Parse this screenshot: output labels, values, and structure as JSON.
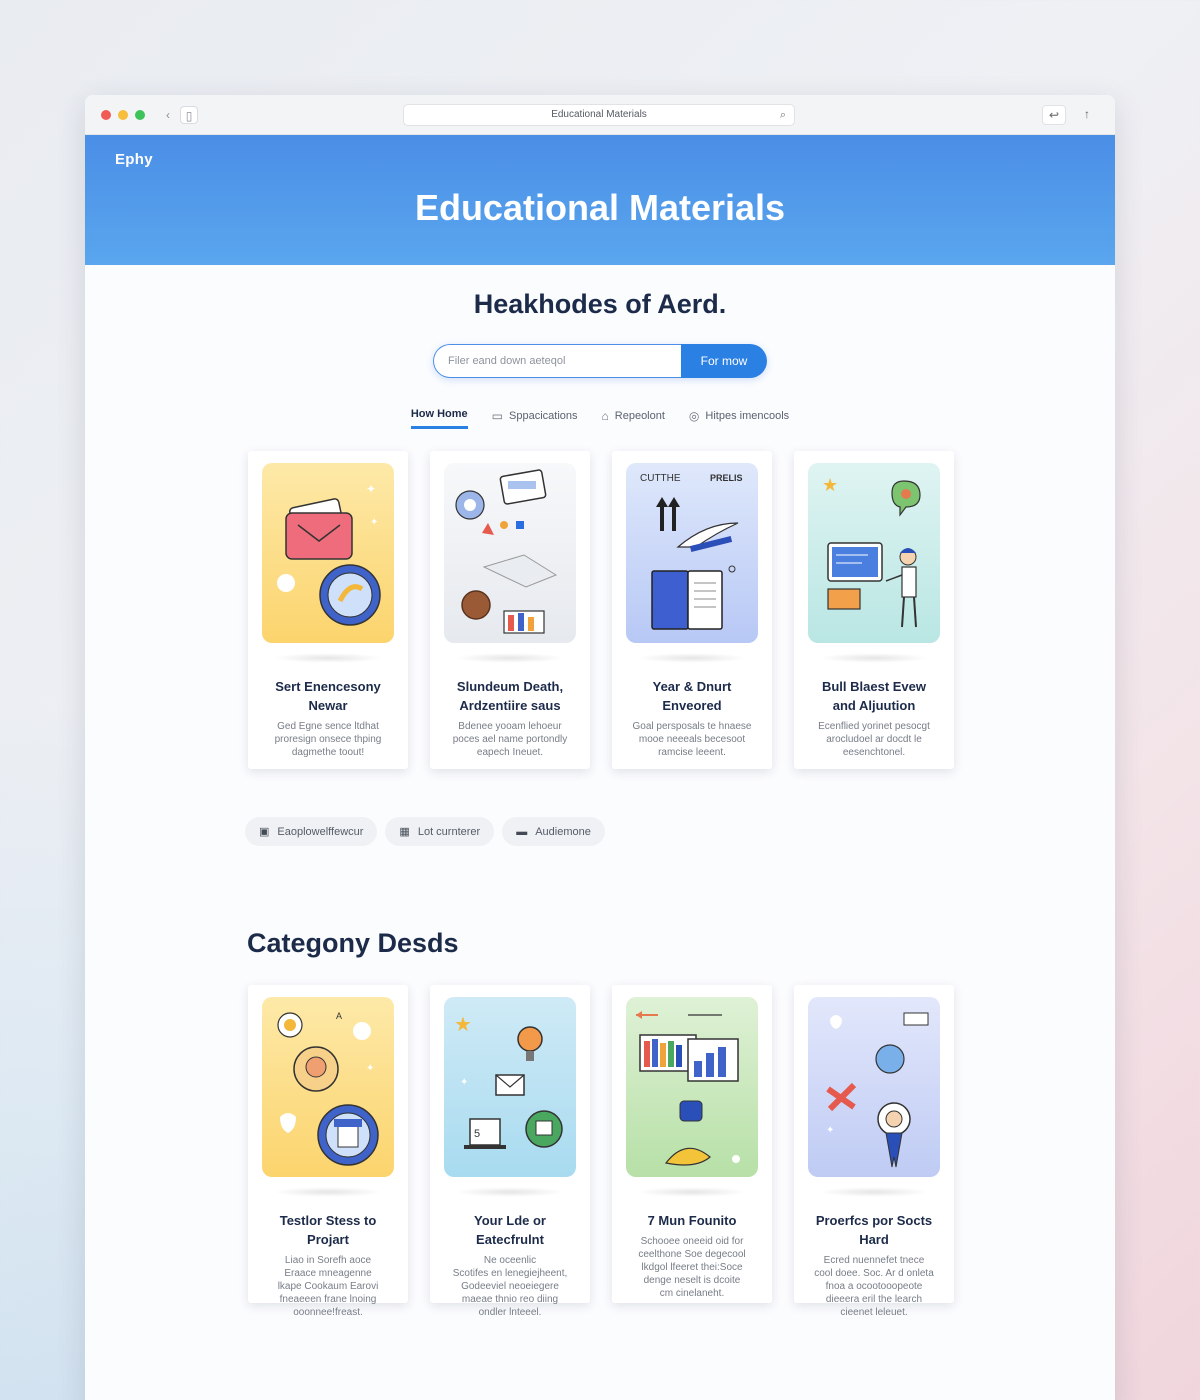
{
  "browser": {
    "address": "Educational Materials",
    "back_glyph": "‹",
    "forward_glyph": "▯"
  },
  "brand": "Ephy",
  "hero_title": "Educational Materials",
  "subtitle": "Heakhodes of Aerd.",
  "search": {
    "placeholder": "Filer eand down aeteqol",
    "button_label": "For mow"
  },
  "tabs": [
    {
      "label": "How Home",
      "icon": "none",
      "active": true
    },
    {
      "label": "Sppacications",
      "icon": "monitor-icon",
      "active": false
    },
    {
      "label": "Repeolont",
      "icon": "lock-icon",
      "active": false
    },
    {
      "label": "Hitpes imencools",
      "icon": "target-icon",
      "active": false
    }
  ],
  "cards_top": [
    {
      "title_line1": "Sert Enencesony",
      "title_line2": "Newar",
      "desc_line1": "Ged Egne sence ltdhat",
      "desc_line2": "proresign onsece thping",
      "desc_line3": "dagmethe toout!",
      "art": "yellow"
    },
    {
      "title_line1": "Slundeum Death,",
      "title_line2": "Ardzentiire saus",
      "desc_line1": "Bdenee yooam lehoeur",
      "desc_line2": "poces ael name portondly",
      "desc_line3": "eapech Ineuet.",
      "art": "grey"
    },
    {
      "title_line1": "Year & Dnurt",
      "title_line2": "Enveored",
      "desc_line1": "Goal persposals te hnaese",
      "desc_line2": "mooe neeeals becesoot",
      "desc_line3": "ramcise leeent.",
      "art": "blue"
    },
    {
      "title_line1": "Bull Blaest Evew",
      "title_line2": "and Aljuution",
      "desc_line1": "Ecenflied yorinet pesocgt",
      "desc_line2": "arocludoel ar docdt le",
      "desc_line3": "eesenchtonel.",
      "art": "mint"
    }
  ],
  "chips": [
    {
      "label": "Eaoplowelffewcur",
      "icon": "window-icon"
    },
    {
      "label": "Lot curnterer",
      "icon": "grid-icon"
    },
    {
      "label": "Audiemone",
      "icon": "audio-icon"
    }
  ],
  "section_title": "Categony Desds",
  "cards_bottom": [
    {
      "title": "Testlor Stess to Projart",
      "desc": [
        "Liao in Sorefh aoce",
        "Eraace mneagenne",
        "lkape Cookaum Earovi",
        "fneaeeen frane lnoing",
        "ooonnee!freast."
      ],
      "art": "yellow"
    },
    {
      "title": "Your Lde or Eatecfrulnt",
      "desc": [
        "Ne oceenlic",
        "Scotifes en lenegiejheent,",
        "Godeeviel neoeiegere",
        "maeae thnio reo diing",
        "ondler lnteeel."
      ],
      "art": "sky"
    },
    {
      "title": "7 Mun Founito",
      "desc": [
        "Schooee oneeid oid for",
        "ceelthone Soe degecool",
        "lkdgol lfeeret thei:Soce",
        "denge neselt is dcoite",
        "cm cinelaneht."
      ],
      "art": "green"
    },
    {
      "title": "Proerfcs por Socts Hard",
      "desc": [
        "Ecred nuennefet tnece",
        "cool doee. Soc. Ar d onleta",
        "fnoa a ocootooopeote",
        "dieeera eril the learch",
        "cieenet leleuet."
      ],
      "art": "lav"
    }
  ],
  "art_labels": {
    "book_left": "CUTTHE",
    "book_right": "PRELIS",
    "coin": "5"
  },
  "colors": {
    "accent": "#2b80e3",
    "hero_top": "#4a8ee6",
    "hero_bottom": "#5aa6ee",
    "heading": "#1d2b4a"
  }
}
